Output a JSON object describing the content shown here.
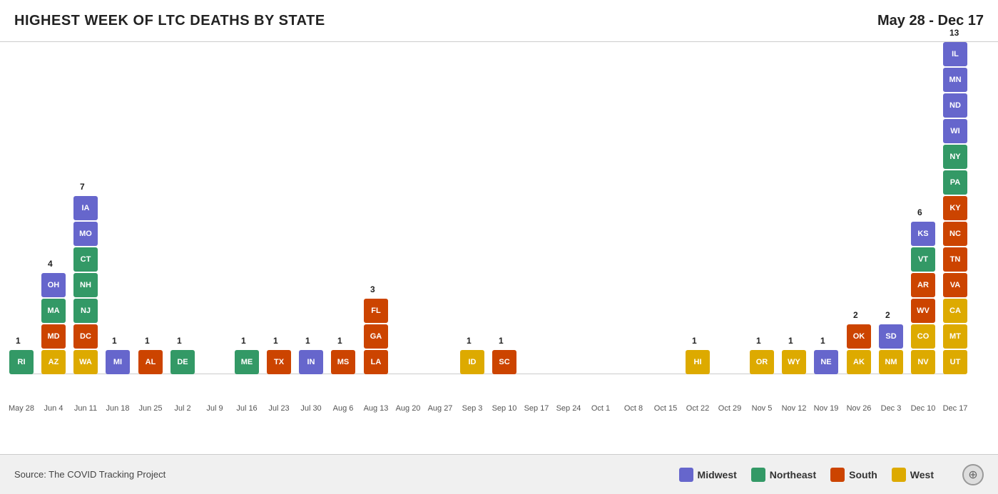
{
  "header": {
    "title": "HIGHEST WEEK OF LTC DEATHS BY STATE",
    "date_range": "May 28 - Dec 17"
  },
  "footer": {
    "source": "Source: The COVID Tracking Project"
  },
  "legend": {
    "items": [
      {
        "label": "Midwest",
        "color": "#6666cc"
      },
      {
        "label": "Northeast",
        "color": "#339966"
      },
      {
        "label": "South",
        "color": "#cc4400"
      },
      {
        "label": "West",
        "color": "#ddaa00"
      }
    ]
  },
  "colors": {
    "midwest": "#6666cc",
    "northeast": "#339966",
    "south": "#cc4400",
    "west": "#ddaa00"
  },
  "x_labels": [
    "May 28",
    "Jun 4",
    "Jun 11",
    "Jun 18",
    "Jun 25",
    "Jul 2",
    "Jul 9",
    "Jul 16",
    "Jul 23",
    "Jul 30",
    "Aug 6",
    "Aug 13",
    "Aug 20",
    "Aug 27",
    "Sep 3",
    "Sep 10",
    "Sep 17",
    "Sep 24",
    "Oct 1",
    "Oct 8",
    "Oct 15",
    "Oct 22",
    "Oct 29",
    "Nov 5",
    "Nov 12",
    "Nov 19",
    "Nov 26",
    "Dec 3",
    "Dec 10",
    "Dec 17"
  ],
  "columns": {
    "May28": {
      "x_pct": 1.5
    },
    "Jun4": {
      "x_pct": 5.0
    },
    "Jun11": {
      "x_pct": 8.5
    },
    "Jun18": {
      "x_pct": 12.0
    },
    "Jun25": {
      "x_pct": 15.5
    },
    "Jul2": {
      "x_pct": 19.0
    },
    "Jul9": {
      "x_pct": 22.5
    },
    "Jul16": {
      "x_pct": 26.0
    },
    "Jul23": {
      "x_pct": 29.5
    },
    "Jul30": {
      "x_pct": 33.0
    },
    "Aug6": {
      "x_pct": 36.5
    },
    "Aug13": {
      "x_pct": 40.0
    },
    "Aug20": {
      "x_pct": 43.5
    },
    "Aug27": {
      "x_pct": 47.0
    },
    "Sep3": {
      "x_pct": 50.5
    },
    "Sep10": {
      "x_pct": 54.0
    },
    "Sep17": {
      "x_pct": 57.5
    },
    "Sep24": {
      "x_pct": 61.0
    },
    "Oct1": {
      "x_pct": 64.5
    },
    "Oct8": {
      "x_pct": 68.0
    },
    "Oct15": {
      "x_pct": 71.5
    },
    "Oct22": {
      "x_pct": 75.0
    },
    "Oct29": {
      "x_pct": 78.5
    },
    "Nov5": {
      "x_pct": 82.0
    },
    "Nov12": {
      "x_pct": 85.5
    },
    "Nov19": {
      "x_pct": 89.0
    },
    "Nov26": {
      "x_pct": 92.5
    },
    "Dec3": {
      "x_pct": 96.0
    },
    "Dec10": {
      "x_pct": 99.5
    },
    "Dec17": {
      "x_pct": 103.0
    }
  }
}
